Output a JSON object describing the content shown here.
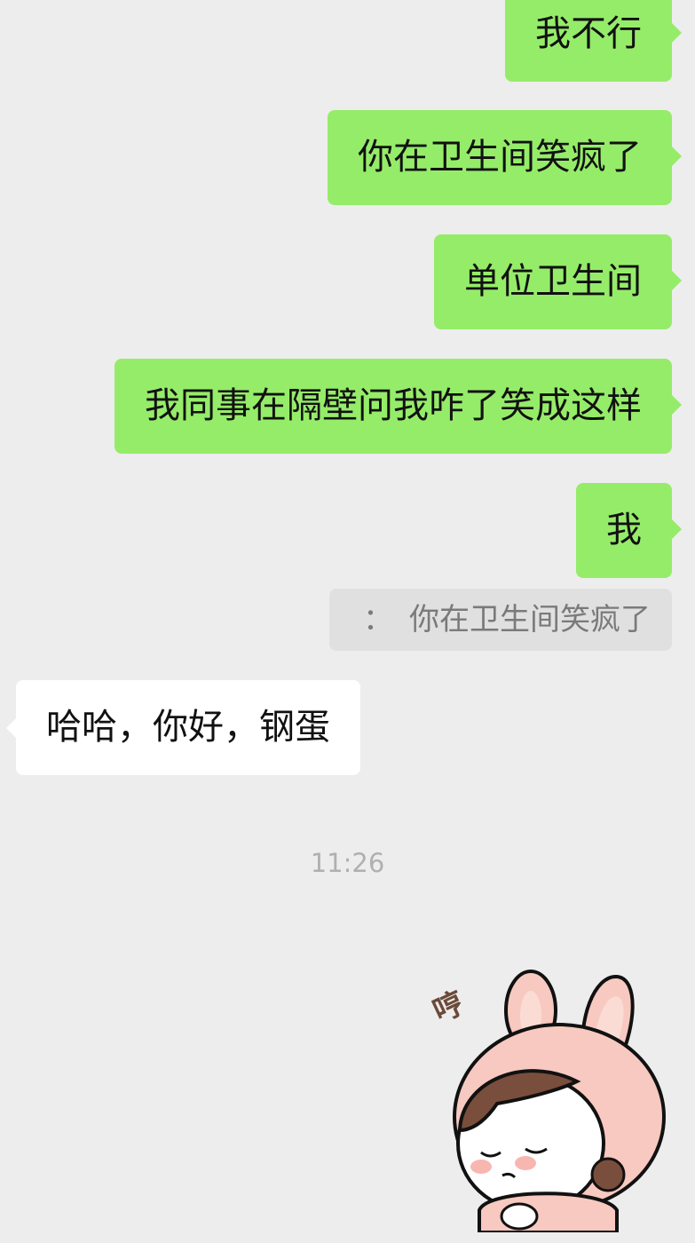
{
  "messages": [
    {
      "direction": "out",
      "text": "我不行"
    },
    {
      "direction": "out",
      "text": "你在卫生间笑疯了"
    },
    {
      "direction": "out",
      "text": "单位卫生间"
    },
    {
      "direction": "out",
      "text": "我同事在隔壁问我咋了笑成这样"
    },
    {
      "direction": "out",
      "text": "我"
    },
    {
      "direction": "in",
      "text": "哈哈，你好，钢蛋"
    }
  ],
  "quote": {
    "separator": "：",
    "text": "你在卫生间笑疯了"
  },
  "timestamp": "11:26",
  "sticker": {
    "name": "bunny-girl-hmph-sticker",
    "caption": "哼"
  },
  "colors": {
    "background": "#ededed",
    "outgoing_bubble": "#95ec69",
    "incoming_bubble": "#ffffff",
    "quote_bubble": "#e0e0e0"
  }
}
